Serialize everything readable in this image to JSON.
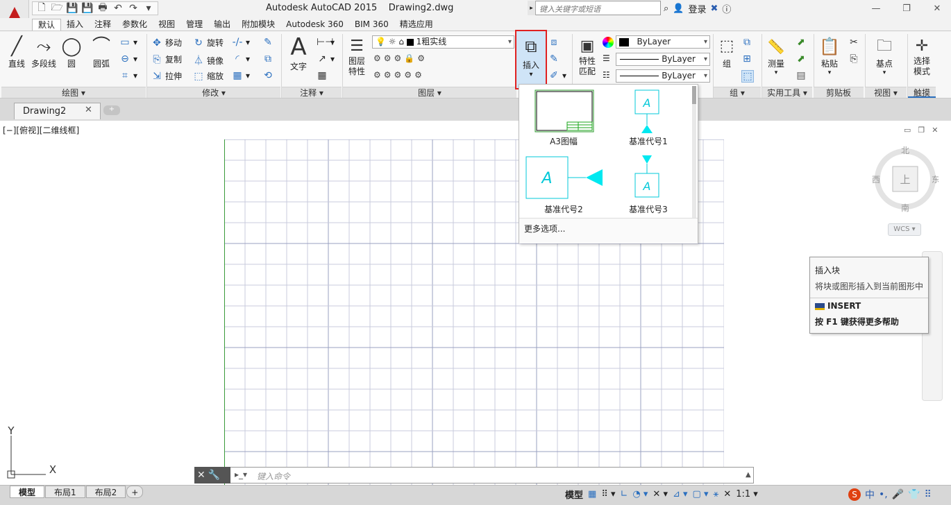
{
  "window": {
    "title": "Autodesk AutoCAD 2015",
    "document": "Drawing2.dwg",
    "search_placeholder": "键入关键字或短语",
    "login": "登录",
    "min": "—",
    "max": "❐",
    "close": "✕"
  },
  "qat": [
    "🗋",
    "🗁",
    "💾",
    "💾",
    "🖶",
    "↶",
    "↷",
    "▾"
  ],
  "tabs": [
    "默认",
    "插入",
    "注释",
    "参数化",
    "视图",
    "管理",
    "输出",
    "附加模块",
    "Autodesk 360",
    "BIM 360",
    "精选应用"
  ],
  "panels": {
    "draw": "绘图 ▾",
    "modify": "修改 ▾",
    "annotation": "注释 ▾",
    "layer": "图层 ▾",
    "group": "组 ▾",
    "utilities": "实用工具 ▾",
    "clipboard": "剪贴板",
    "view": "视图 ▾",
    "touch": "触摸"
  },
  "draw": {
    "line": "直线",
    "polyline": "多段线",
    "circle": "圆",
    "arc": "圆弧"
  },
  "modify": {
    "move": "移动",
    "rotate": "旋转",
    "copy": "复制",
    "mirror": "镜像",
    "stretch": "拉伸",
    "scale": "缩放"
  },
  "annotation": {
    "text": "文字"
  },
  "layer": {
    "props_l1": "图层",
    "props_l2": "特性",
    "current": "1粗实线"
  },
  "block": {
    "insert": "插入"
  },
  "properties": {
    "match_l1": "特性",
    "match_l2": "匹配",
    "color": "ByLayer",
    "linetype": "ByLayer",
    "lineweight": "ByLayer"
  },
  "group": {
    "label": "组"
  },
  "utilities": {
    "measure": "测量"
  },
  "clipboard": {
    "paste": "粘贴"
  },
  "view": {
    "base": "基点"
  },
  "touch": {
    "select_l1": "选择",
    "select_l2": "模式"
  },
  "doc": {
    "tab": "Drawing2",
    "close": "✕",
    "view_label": "[−][俯视][二维线框]"
  },
  "gallery": {
    "items": [
      "A3图幅",
      "基准代号1",
      "基准代号2",
      "基准代号3"
    ],
    "more": "更多选项..."
  },
  "tooltip": {
    "title": "插入块",
    "desc": "将块或图形插入到当前图形中",
    "command": "INSERT",
    "help": "按 F1 键获得更多帮助"
  },
  "viewcube": {
    "north": "北",
    "south": "南",
    "east": "东",
    "west": "西",
    "top": "上",
    "wcs": "WCS ▾"
  },
  "ucs": {
    "x": "X",
    "y": "Y"
  },
  "cmd": {
    "placeholder": "键入命令"
  },
  "layout": {
    "tabs": [
      "模型",
      "布局1",
      "布局2"
    ]
  },
  "status": {
    "model": "模型",
    "scale": "1:1 ▾"
  }
}
